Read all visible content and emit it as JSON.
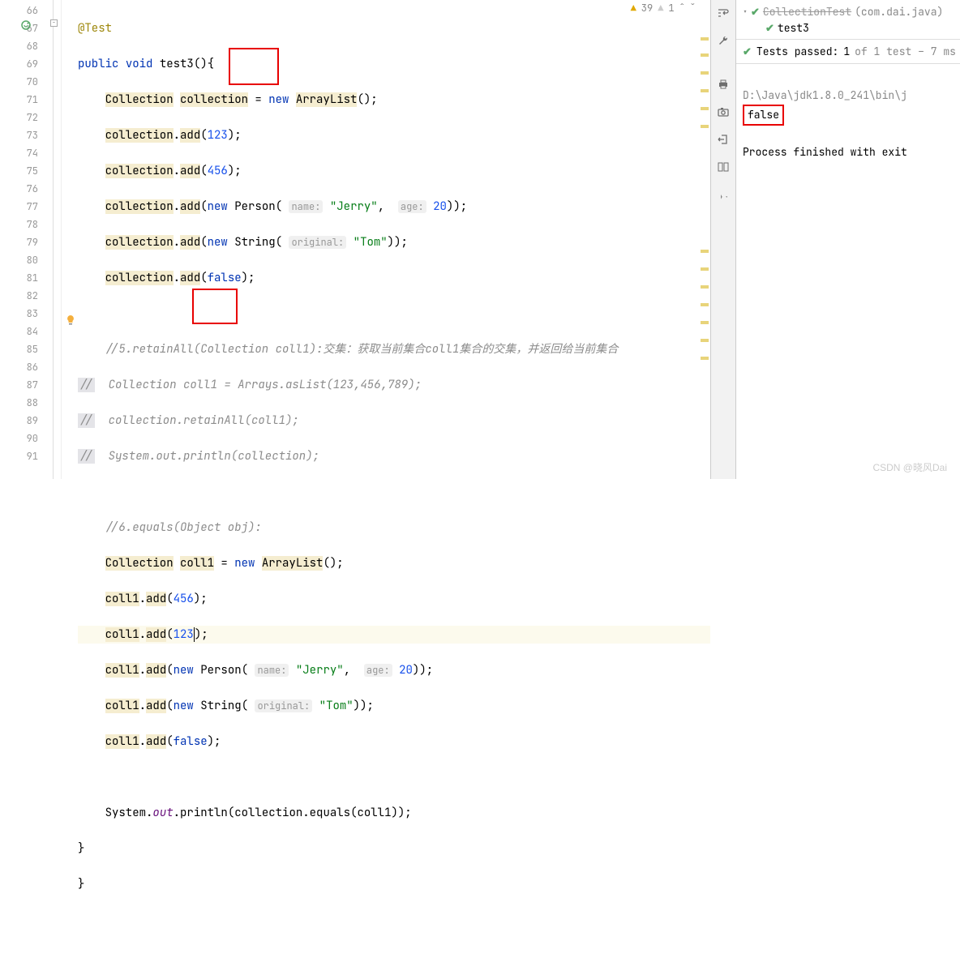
{
  "inspections": {
    "warn_count": "39",
    "warn2": "1"
  },
  "gutter_lines": [
    "66",
    "67",
    "68",
    "69",
    "70",
    "71",
    "72",
    "73",
    "74",
    "75",
    "76",
    "77",
    "78",
    "79",
    "80",
    "81",
    "82",
    "83",
    "84",
    "85",
    "86",
    "87",
    "88",
    "89",
    "90",
    "91"
  ],
  "code": {
    "ann": "@Test",
    "kw_public": "public",
    "kw_void": "void",
    "fn_name": "test3",
    "kw_new": "new",
    "type_collection": "Collection",
    "var_collection": "collection",
    "type_arraylist": "ArrayList",
    "m_add": "add",
    "n123": "123",
    "n456": "456",
    "n789": "789",
    "type_person": "Person",
    "hint_name": "name:",
    "str_jerry": "\"Jerry\"",
    "hint_age": "age:",
    "n20": "20",
    "type_string": "String",
    "hint_original": "original:",
    "str_tom": "\"Tom\"",
    "kw_false": "false",
    "c5": "//5.retainAll(Collection coll1):交集：获取当前集合coll1集合的交集，并返回给当前集合",
    "c5a": "  Collection coll1 = Arrays.asList(123,456,789);",
    "c5b": "  collection.retainAll(coll1);",
    "c5c": "  System.out.println(collection);",
    "slash": "//",
    "c6": "//6.equals(Object obj):",
    "var_coll1": "coll1",
    "sys": "System",
    "out": "out",
    "println": "println",
    "equals": "equals"
  },
  "test_tree": {
    "class_name": "CollectionTest",
    "class_pkg": "(com.dai.java)",
    "test_name": "test3"
  },
  "status": {
    "label": "Tests passed:",
    "passed": "1",
    "rest": "of 1 test – 7 ms"
  },
  "console": {
    "path": "D:\\Java\\jdk1.8.0_241\\bin\\j",
    "out_false": "false",
    "exit": "Process finished with exit"
  },
  "watermark": "CSDN @晓风Dai"
}
